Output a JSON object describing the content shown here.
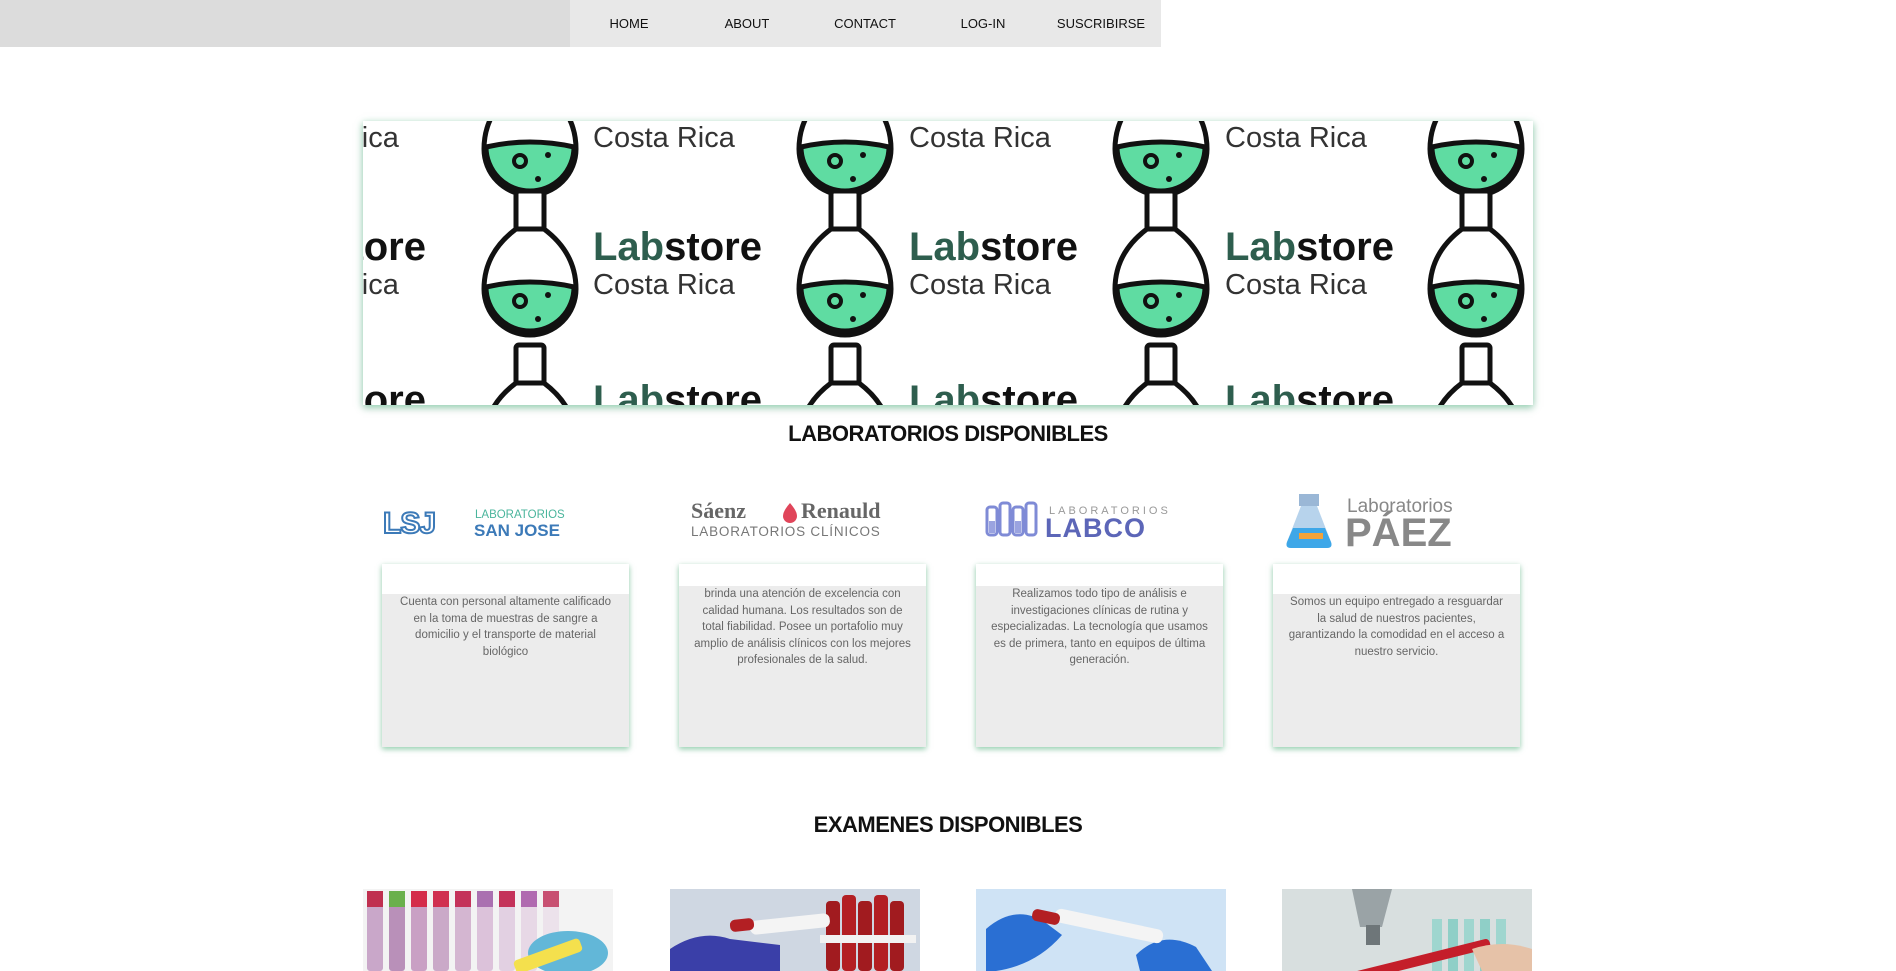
{
  "nav": {
    "items": [
      {
        "label": "HOME"
      },
      {
        "label": "ABOUT"
      },
      {
        "label": "CONTACT"
      },
      {
        "label": "LOG-IN"
      },
      {
        "label": "SUSCRIBIRSE"
      }
    ]
  },
  "banner": {
    "brand_lab": "Lab",
    "brand_store": "store",
    "brand_country": "Costa Rica",
    "accent_color": "#5fdca2",
    "dark_green": "#2e5e4e"
  },
  "labs": {
    "title": "LABORATORIOS DISPONIBLES",
    "items": [
      {
        "logo_icon": "LSJ",
        "logo_line1": "LABORATORIOS",
        "logo_line2": "SAN JOSE",
        "description": "Cuenta con personal altamente calificado en la toma de muestras de sangre a domicilio y el transporte de material biológico"
      },
      {
        "logo_line1": "Sáenz",
        "logo_line1b": "Renauld",
        "logo_line2": "LABORATORIOS CLÍNICOS",
        "description": "brinda una atención de excelencia con calidad humana. Los resultados son de total fiabilidad. Posee un portafolio muy amplio de análisis clínicos con los mejores profesionales de la salud."
      },
      {
        "logo_line1": "LABORATORIOS",
        "logo_line2": "LABCO",
        "description": "Realizamos todo tipo de análisis e investigaciones clínicas de rutina y especializadas. La tecnología que usamos es de primera, tanto en equipos de última generación."
      },
      {
        "logo_line1": "Laboratorios",
        "logo_line2": "PÁEZ",
        "description": "Somos un equipo entregado a resguardar la salud de nuestros pacientes, garantizando la comodidad en el acceso a nuestro servicio."
      }
    ]
  },
  "exams": {
    "title": "EXAMENES DISPONIBLES",
    "items": [
      {
        "image": "blood-tubes-rack-image"
      },
      {
        "image": "blood-test-tube-gloves-image"
      },
      {
        "image": "allergy-test-tube-image"
      },
      {
        "image": "microscope-sample-image"
      }
    ]
  }
}
